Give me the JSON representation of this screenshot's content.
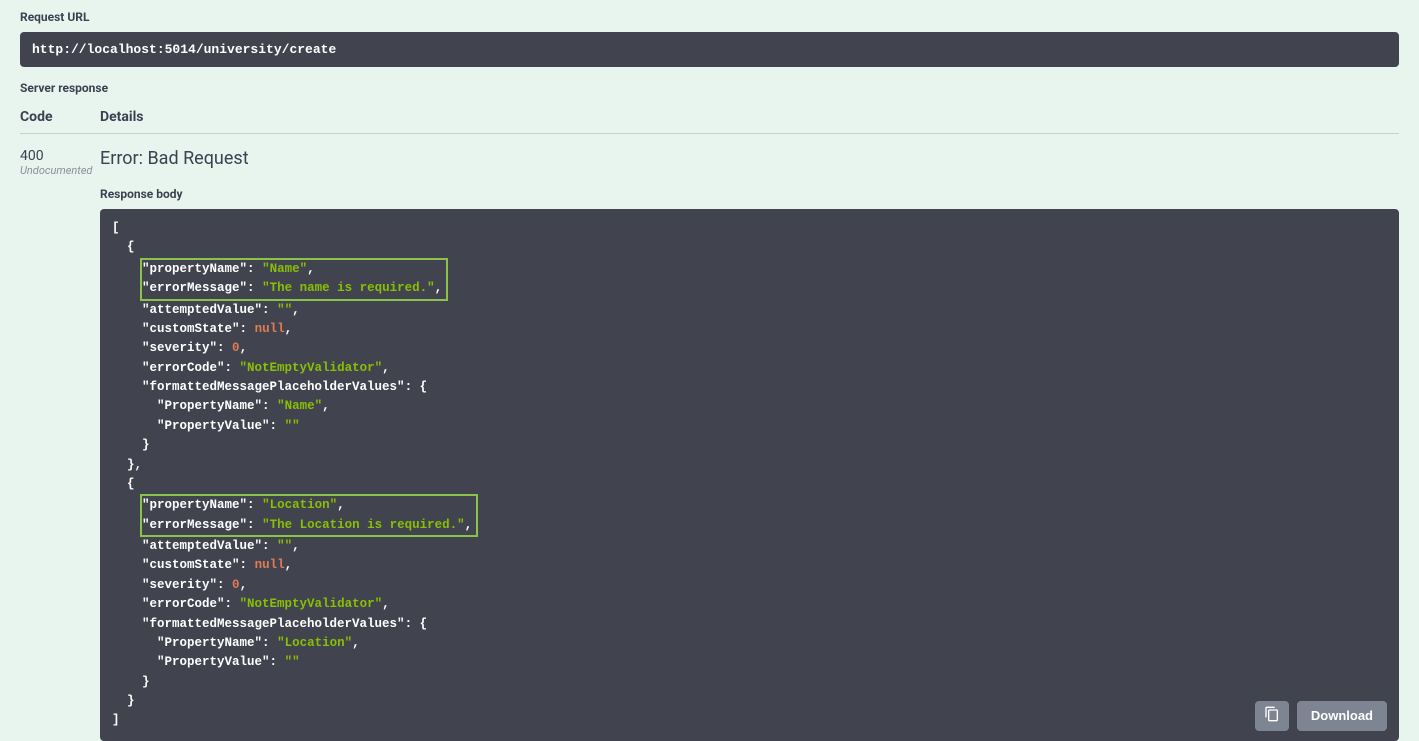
{
  "request_url_label": "Request URL",
  "request_url": "http://localhost:5014/university/create",
  "server_response_label": "Server response",
  "headers": {
    "code": "Code",
    "details": "Details"
  },
  "response": {
    "code": "400",
    "undocumented": "Undocumented",
    "error_title": "Error: Bad Request",
    "body_label": "Response body"
  },
  "json_body": [
    {
      "propertyName": "Name",
      "errorMessage": "The name is required.",
      "attemptedValue": "",
      "customState": null,
      "severity": 0,
      "errorCode": "NotEmptyValidator",
      "formattedMessagePlaceholderValues": {
        "PropertyName": "Name",
        "PropertyValue": ""
      }
    },
    {
      "propertyName": "Location",
      "errorMessage": "The Location is required.",
      "attemptedValue": "",
      "customState": null,
      "severity": 0,
      "errorCode": "NotEmptyValidator",
      "formattedMessagePlaceholderValues": {
        "PropertyName": "Location",
        "PropertyValue": ""
      }
    }
  ],
  "buttons": {
    "download": "Download"
  },
  "icons": {
    "clipboard": "clipboard-icon"
  }
}
